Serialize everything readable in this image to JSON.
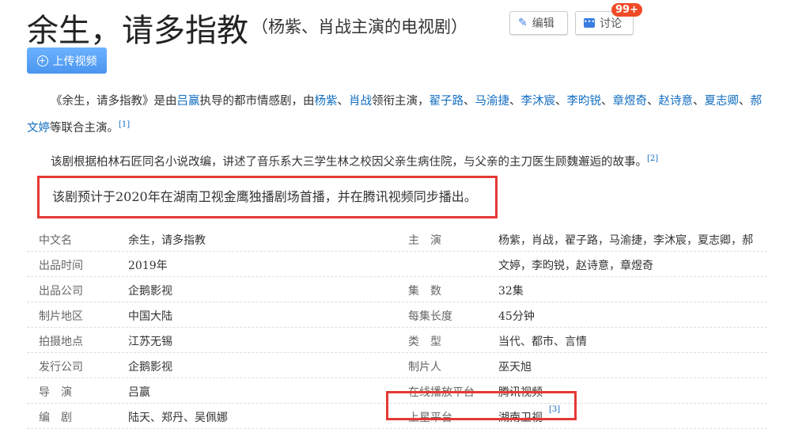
{
  "title": "余生，请多指教",
  "subtitle": "（杨紫、肖战主演的电视剧）",
  "edit_label": "编辑",
  "discuss_label": "讨论",
  "discuss_badge": "99+",
  "upload_label": "上传视频",
  "para1": [
    {
      "t": "《余生，请多指教》是由"
    },
    {
      "t": "吕赢",
      "l": 1
    },
    {
      "t": "执导的都市情感剧，由"
    },
    {
      "t": "杨紫",
      "l": 1
    },
    {
      "t": "、"
    },
    {
      "t": "肖战",
      "l": 1
    },
    {
      "t": "领衔主演，"
    },
    {
      "t": "翟子路",
      "l": 1
    },
    {
      "t": "、"
    },
    {
      "t": "马渝捷",
      "l": 1
    },
    {
      "t": "、"
    },
    {
      "t": "李沐宸",
      "l": 1
    },
    {
      "t": "、"
    },
    {
      "t": "李昀锐",
      "l": 1
    },
    {
      "t": "、"
    },
    {
      "t": "章煜奇",
      "l": 1
    },
    {
      "t": "、"
    },
    {
      "t": "赵诗意",
      "l": 1
    },
    {
      "t": "、"
    },
    {
      "t": "夏志卿",
      "l": 1
    },
    {
      "t": "、"
    },
    {
      "t": "郝文婷",
      "l": 1
    },
    {
      "t": "等联合主演。"
    }
  ],
  "para1_ref": "[1]",
  "para2": "该剧根据柏林石匠同名小说改编，讲述了音乐系大三学生林之校因父亲生病住院，与父亲的主刀医生顾魏邂逅的故事。",
  "para2_ref": "[2]",
  "para3": "该剧预计于2020年在湖南卫视金鹰独播剧场首播，并在腾讯视频同步播出。",
  "rows": [
    {
      "k1": "中文名",
      "v1": "余生，请多指教",
      "k2": "主　演",
      "v2": "杨紫，肖战，翟子路，马渝捷，李沐宸，夏志卿，郝"
    },
    {
      "k1": "出品时间",
      "v1": "2019年",
      "k2": "",
      "v2": "文婷，李昀锐，赵诗意，章煜奇"
    },
    {
      "k1": "出品公司",
      "v1": "企鹅影视",
      "k2": "集　数",
      "v2": "32集"
    },
    {
      "k1": "制片地区",
      "v1": "中国大陆",
      "k2": "每集长度",
      "v2": "45分钟"
    },
    {
      "k1": "拍摄地点",
      "v1": "江苏无锡",
      "k2": "类　型",
      "v2": "当代、都市、言情"
    },
    {
      "k1": "发行公司",
      "v1": "企鹅影视",
      "k2": "制片人",
      "v2": "巫天旭"
    },
    {
      "k1": "导　演",
      "v1": "吕赢",
      "k2": "在线播放平台",
      "v2": "腾讯视频"
    },
    {
      "k1": "编　剧",
      "v1": "陆天、郑丹、吴佩娜",
      "k2": "上星平台",
      "v2": "湖南卫视"
    }
  ],
  "last_ref": "[3]"
}
